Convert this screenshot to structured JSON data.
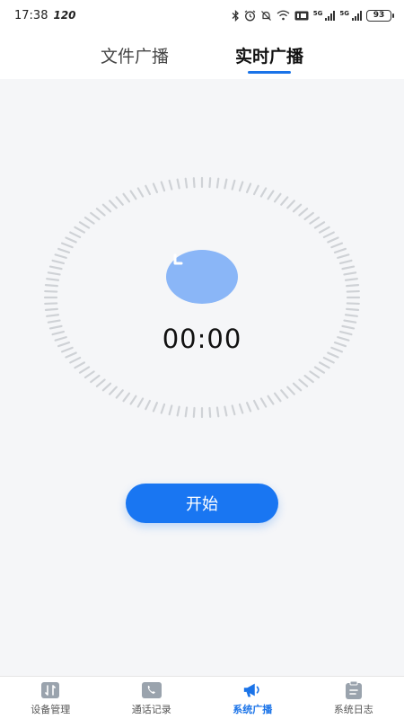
{
  "status_bar": {
    "time": "17:38",
    "refresh_rate": "120",
    "network_1": "5G",
    "network_2": "5G",
    "battery": "93"
  },
  "tabs": [
    {
      "label": "文件广播",
      "active": false
    },
    {
      "label": "实时广播",
      "active": true
    }
  ],
  "timer": {
    "value": "00:00",
    "icon": "clock-icon"
  },
  "start_button": {
    "label": "开始"
  },
  "bottom_nav": [
    {
      "label": "设备管理",
      "icon": "device-manage-icon",
      "active": false
    },
    {
      "label": "通话记录",
      "icon": "phone-icon",
      "active": false
    },
    {
      "label": "系统广播",
      "icon": "megaphone-icon",
      "active": true
    },
    {
      "label": "系统日志",
      "icon": "clipboard-icon",
      "active": false
    }
  ],
  "colors": {
    "accent": "#1a73e8",
    "button": "#1976f2",
    "clock_fill": "#8ab6f7",
    "tick": "#cfd2d6",
    "background": "#f5f6f8",
    "nav_inactive_icon": "#9aa3ad"
  }
}
